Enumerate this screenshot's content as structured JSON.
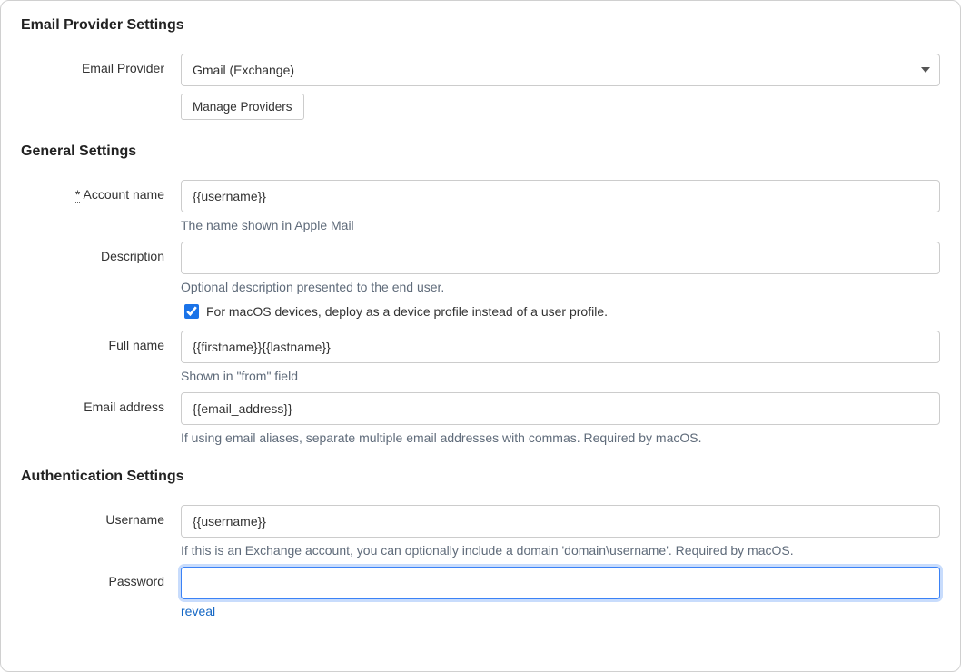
{
  "sections": {
    "emailProvider": "Email Provider Settings",
    "general": "General Settings",
    "auth": "Authentication Settings"
  },
  "emailProvider": {
    "label": "Email Provider",
    "selected": "Gmail (Exchange)",
    "manageBtn": "Manage Providers"
  },
  "accountName": {
    "label": "Account name",
    "required": "*",
    "value": "{{username}}",
    "help": "The name shown in Apple Mail"
  },
  "description": {
    "label": "Description",
    "value": "",
    "help": "Optional description presented to the end user.",
    "checkboxLabel": "For macOS devices, deploy as a device profile instead of a user profile."
  },
  "fullName": {
    "label": "Full name",
    "value": "{{firstname}}{{lastname}}",
    "help": "Shown in \"from\" field"
  },
  "emailAddress": {
    "label": "Email address",
    "value": "{{email_address}}",
    "help": "If using email aliases, separate multiple email addresses with commas. Required by macOS."
  },
  "username": {
    "label": "Username",
    "value": "{{username}}",
    "help": "If this is an Exchange account, you can optionally include a domain 'domain\\username'. Required by macOS."
  },
  "password": {
    "label": "Password",
    "value": "",
    "reveal": "reveal"
  }
}
